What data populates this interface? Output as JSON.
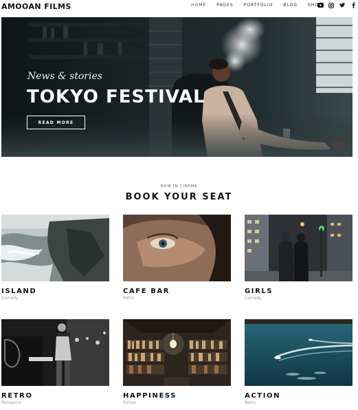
{
  "header": {
    "logo": "AMOOAN FILMS",
    "nav": [
      "HOME",
      "PAGES",
      "PORTFOLIO",
      "BLOG",
      "SHOP"
    ],
    "social_icons": [
      "youtube-icon",
      "instagram-icon",
      "twitter-icon",
      "facebook-icon"
    ]
  },
  "hero": {
    "subtitle": "News & stories",
    "title": "TOKYO FESTIVAL",
    "button": "READ MORE"
  },
  "section": {
    "kicker": "NOW IN CINEMA",
    "title": "BOOK YOUR SEAT"
  },
  "movies": [
    {
      "title": "ISLAND",
      "genre": "Comedy"
    },
    {
      "title": "CAFE BAR",
      "genre": "Retro"
    },
    {
      "title": "GIRLS",
      "genre": "Comedy"
    },
    {
      "title": "RETRO",
      "genre": "Romance"
    },
    {
      "title": "HAPPINESS",
      "genre": "Fiction"
    },
    {
      "title": "ACTION",
      "genre": "Retro"
    }
  ]
}
